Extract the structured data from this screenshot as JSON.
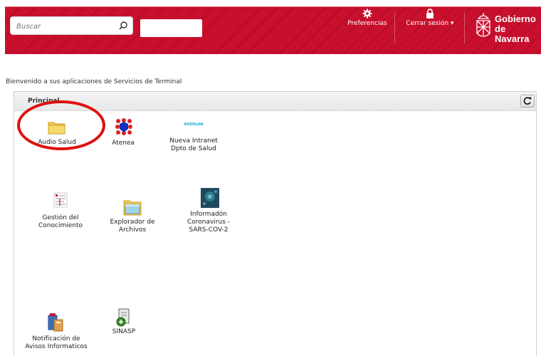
{
  "header": {
    "search_placeholder": "Buscar",
    "preferences_label": "Preferencias",
    "logout_label": "Cerrar sesión ▾",
    "logo_line1": "Gobierno",
    "logo_line2": "de Navarra"
  },
  "welcome_text": "Bienvenido a sus aplicaciones de Servicios de Terminal",
  "panel": {
    "title": "Principal"
  },
  "apps": {
    "audio": {
      "label": "Audio Salud"
    },
    "atenea": {
      "label": "Atenea"
    },
    "intranet": {
      "label_1": "Nueva Intranet",
      "label_2": "Dpto de Salud",
      "badge": "AUZOLAN"
    },
    "gestion": {
      "label_1": "Gestión del",
      "label_2": "Conocimiento"
    },
    "explorador": {
      "label_1": "Explorador de",
      "label_2": "Archivos"
    },
    "coronavirus": {
      "label_1": "Informadón",
      "label_2": "Coronavirus -",
      "label_3": "SARS-COV-2"
    },
    "notificacion": {
      "label_1": "Notificación de",
      "label_2": "Avisos Informaticos"
    },
    "sinasp": {
      "label": "SINASP"
    }
  },
  "colors": {
    "header_red": "#c8102e",
    "annotation_circle": "#e01010"
  }
}
